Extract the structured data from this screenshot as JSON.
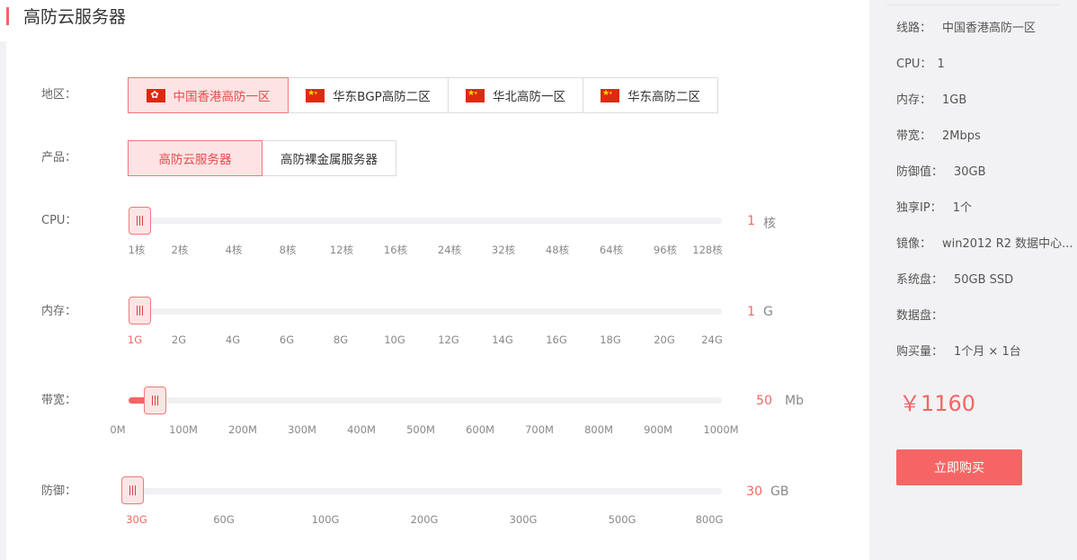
{
  "header": {
    "title": "高防云服务器"
  },
  "region": {
    "label": "地区：",
    "options": [
      {
        "label": "中国香港高防一区",
        "flag": "hk-flag-icon",
        "active": true
      },
      {
        "label": "华东BGP高防二区",
        "flag": "cn-flag-icon",
        "active": false
      },
      {
        "label": "华北高防一区",
        "flag": "cn-flag-icon",
        "active": false
      },
      {
        "label": "华东高防二区",
        "flag": "cn-flag-icon",
        "active": false
      }
    ]
  },
  "product": {
    "label": "产品：",
    "options": [
      {
        "label": "高防云服务器",
        "active": true
      },
      {
        "label": "高防裸金属服务器",
        "active": false
      }
    ]
  },
  "sliders": {
    "cpu": {
      "label": "CPU：",
      "value": "1",
      "unit": "核",
      "ticks": [
        "1核",
        "2核",
        "4核",
        "8核",
        "12核",
        "16核",
        "24核",
        "32核",
        "48核",
        "64核",
        "96核",
        "128核"
      ],
      "active_tick": -1
    },
    "memory": {
      "label": "内存：",
      "value": "1",
      "unit": "G",
      "ticks": [
        "1G",
        "2G",
        "4G",
        "6G",
        "8G",
        "10G",
        "12G",
        "14G",
        "16G",
        "18G",
        "20G",
        "24G"
      ],
      "active_tick": 0
    },
    "bandwidth": {
      "label": "带宽：",
      "value": "50",
      "unit": "Mb",
      "ticks": [
        "0M",
        "100M",
        "200M",
        "300M",
        "400M",
        "500M",
        "600M",
        "700M",
        "800M",
        "900M",
        "1000M"
      ],
      "active_tick": -1
    },
    "defense": {
      "label": "防御：",
      "value": "30",
      "unit": "GB",
      "ticks": [
        "30G",
        "60G",
        "100G",
        "200G",
        "300G",
        "500G",
        "800G"
      ],
      "active_tick": 0
    }
  },
  "summary": {
    "rows": [
      {
        "key": "线路：",
        "value": "中国香港高防一区"
      },
      {
        "key": "CPU：",
        "value": "1"
      },
      {
        "key": "内存：",
        "value": "1GB"
      },
      {
        "key": "带宽：",
        "value": "2Mbps"
      },
      {
        "key": "防御值：",
        "value": "30GB"
      },
      {
        "key": "独享IP：",
        "value": "1个"
      },
      {
        "key": "镜像：",
        "value": "win2012 R2 数据中心..."
      },
      {
        "key": "系统盘：",
        "value": "50GB SSD"
      },
      {
        "key": "数据盘：",
        "value": ""
      },
      {
        "key": "购买量：",
        "value": "1个月 × 1台"
      }
    ],
    "price": "￥1160",
    "buy_label": "立即购买"
  },
  "colors": {
    "accent": "#f56565",
    "active_bg": "#fde3e3",
    "track": "#f1f1f3"
  }
}
